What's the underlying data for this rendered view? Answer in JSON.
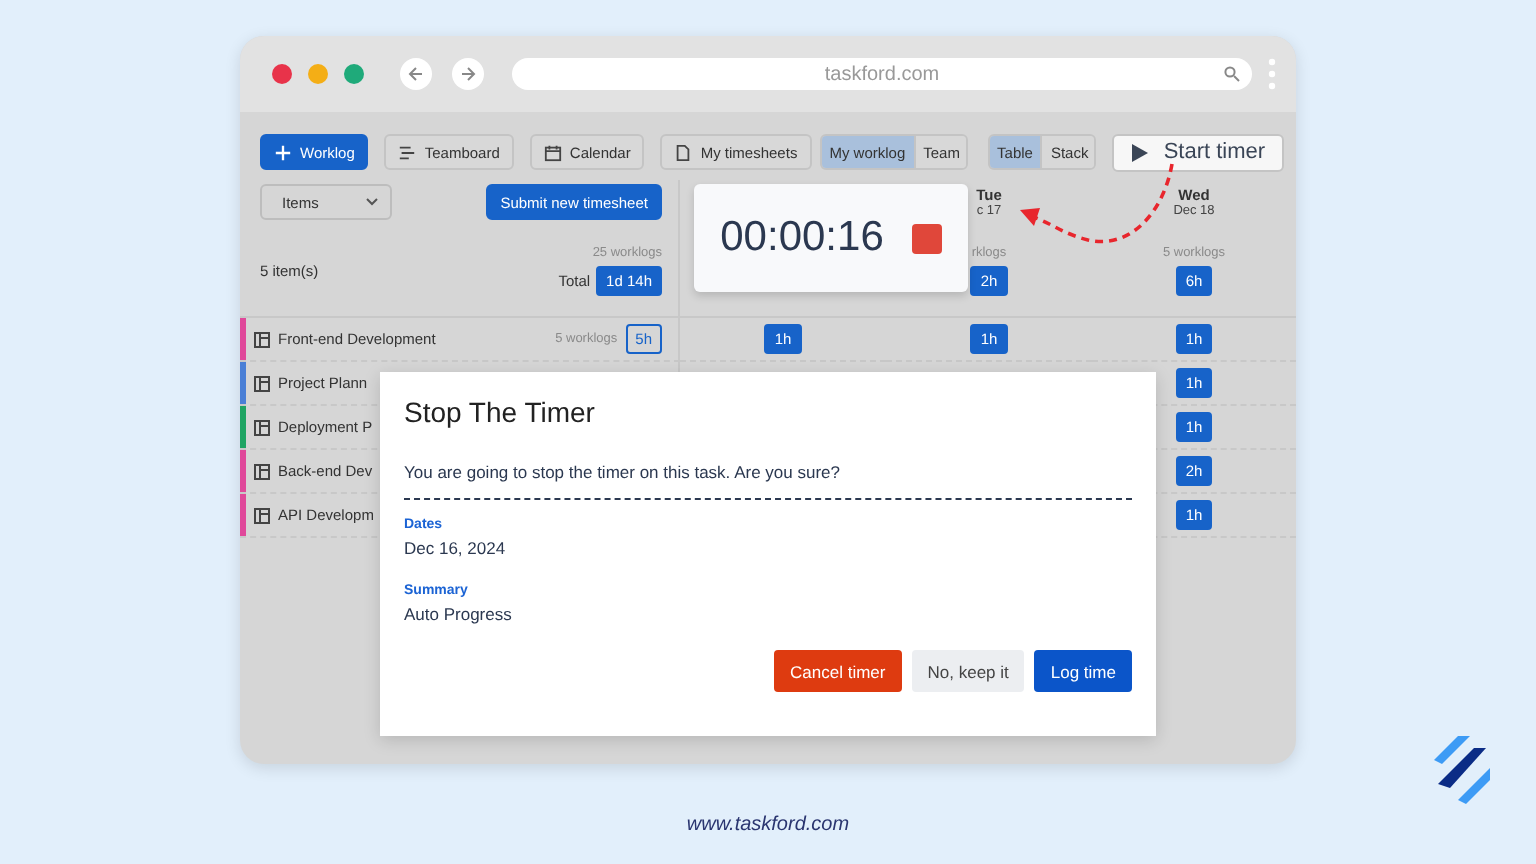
{
  "browser": {
    "url": "taskford.com"
  },
  "toolbar": [
    {
      "label": "Worklog",
      "kind": "primary"
    },
    {
      "label": "Teamboard",
      "kind": "default"
    },
    {
      "label": "Calendar",
      "kind": "default"
    },
    {
      "label": "My timesheets",
      "kind": "default"
    }
  ],
  "view_switch": [
    {
      "label": "My worklog",
      "selected": true
    },
    {
      "label": "Team",
      "selected": false
    }
  ],
  "layout_switch": [
    {
      "label": "Table",
      "selected": true
    },
    {
      "label": "Stack",
      "selected": false
    }
  ],
  "start_timer": {
    "label": "Start timer"
  },
  "filter": {
    "value": "Items"
  },
  "submit_button": {
    "label": "Submit new timesheet"
  },
  "summary": {
    "count": "5 item(s)",
    "worklogs": "25 worklogs",
    "total_label": "Total",
    "total": "1d 14h"
  },
  "days": [
    {
      "day": "Tue",
      "date": "c 17",
      "worklogs": "rklogs",
      "total": "2h"
    },
    {
      "day": "Wed",
      "date": "Dec 18",
      "worklogs": "5 worklogs",
      "total": "6h"
    }
  ],
  "rows": [
    {
      "name": "Front-end Development",
      "color": "#e0489a",
      "worklogs": "5 worklogs",
      "total": "5h",
      "cells": [
        "1h",
        "1h",
        "1h"
      ]
    },
    {
      "name": "Project Plann",
      "color": "#4a7fd6",
      "cells": [
        null,
        null,
        "1h"
      ]
    },
    {
      "name": "Deployment P",
      "color": "#1fa463",
      "cells": [
        null,
        null,
        "1h"
      ]
    },
    {
      "name": "Back-end Dev",
      "color": "#e0489a",
      "cells": [
        null,
        null,
        "2h"
      ]
    },
    {
      "name": "API Developm",
      "color": "#e0489a",
      "cells": [
        null,
        null,
        "1h"
      ]
    }
  ],
  "timer": {
    "time": "00:00:16"
  },
  "dialog": {
    "title": "Stop The Timer",
    "message": "You are going to stop the timer on this task. Are you sure?",
    "fields": [
      {
        "label": "Dates",
        "value": "Dec 16, 2024"
      },
      {
        "label": "Summary",
        "value": "Auto Progress"
      }
    ],
    "buttons": [
      {
        "label": "Cancel timer",
        "kind": "danger"
      },
      {
        "label": "No, keep it",
        "kind": "neutral"
      },
      {
        "label": "Log time",
        "kind": "primary"
      }
    ]
  },
  "footer": {
    "url": "www.taskford.com"
  }
}
